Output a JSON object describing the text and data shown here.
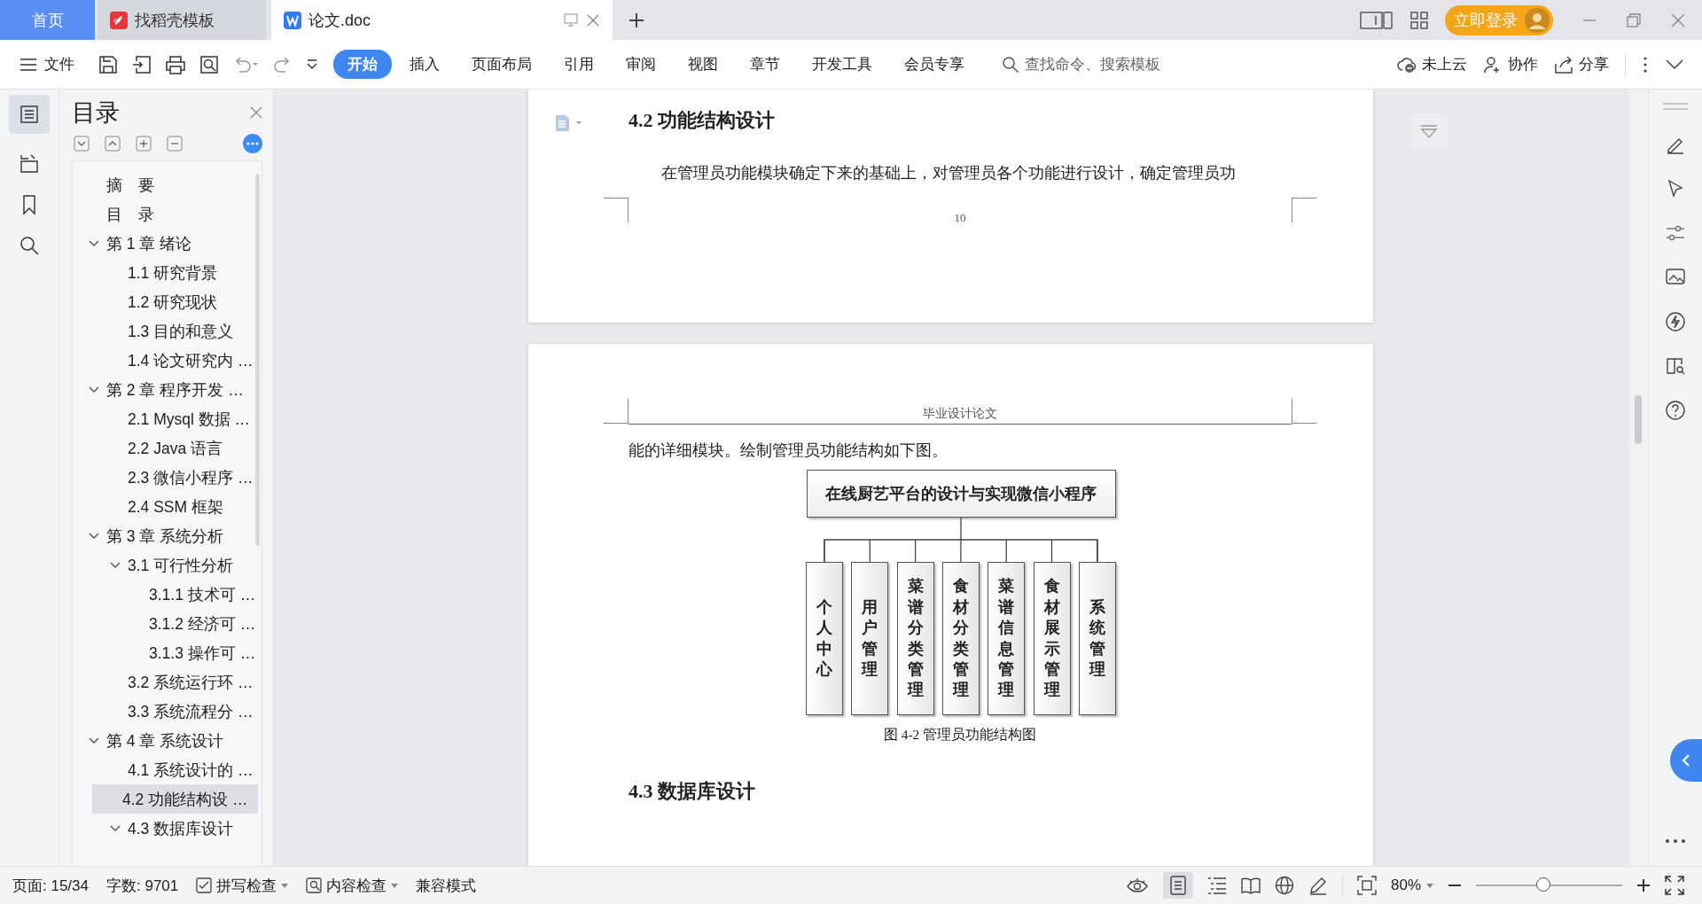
{
  "tabs": [
    {
      "kind": "home",
      "label": "首页",
      "selected": false
    },
    {
      "kind": "template",
      "label": "找稻壳模板",
      "selected": false
    },
    {
      "kind": "doc",
      "label": "论文.doc",
      "selected": true
    }
  ],
  "title_bar": {
    "login": "立即登录"
  },
  "toolbar": {
    "file_menu": "文件",
    "ribbon_tabs": [
      {
        "label": "开始",
        "selected": true
      },
      {
        "label": "插入",
        "selected": false
      },
      {
        "label": "页面布局",
        "selected": false
      },
      {
        "label": "引用",
        "selected": false
      },
      {
        "label": "审阅",
        "selected": false
      },
      {
        "label": "视图",
        "selected": false
      },
      {
        "label": "章节",
        "selected": false
      },
      {
        "label": "开发工具",
        "selected": false
      },
      {
        "label": "会员专享",
        "selected": false
      }
    ],
    "search": {
      "placeholder": "查找命令、搜索模板"
    },
    "actions": [
      {
        "kind": "cloud",
        "label": "未上云"
      },
      {
        "kind": "collab",
        "label": "协作"
      },
      {
        "kind": "share",
        "label": "分享"
      }
    ]
  },
  "toc": {
    "title": "目录",
    "items": [
      {
        "text": "摘　要",
        "selected": false
      },
      {
        "text": "目　录",
        "selected": false
      },
      {
        "text": "第 1 章  绪论",
        "selected": false,
        "expanded": true,
        "children": [
          {
            "text": "1.1  研究背景",
            "selected": false
          },
          {
            "text": "1.2  研究现状",
            "selected": false
          },
          {
            "text": "1.3  目的和意义",
            "selected": false
          },
          {
            "text": "1.4  论文研究内 …",
            "selected": false
          }
        ]
      },
      {
        "text": "第 2 章  程序开发 …",
        "selected": false,
        "expanded": true,
        "children": [
          {
            "text": "2.1 Mysql 数据 …",
            "selected": false
          },
          {
            "text": "2.2 Java 语言",
            "selected": false
          },
          {
            "text": "2.3  微信小程序 …",
            "selected": false
          },
          {
            "text": "2.4 SSM 框架",
            "selected": false
          }
        ]
      },
      {
        "text": "第 3 章  系统分析",
        "selected": false,
        "expanded": true,
        "children": [
          {
            "text": "3.1 可行性分析",
            "selected": false,
            "expanded": true,
            "children": [
              {
                "text": "3.1.1 技术可 …",
                "selected": false
              },
              {
                "text": "3.1.2 经济可 …",
                "selected": false
              },
              {
                "text": "3.1.3 操作可 …",
                "selected": false
              }
            ]
          },
          {
            "text": "3.2 系统运行环 …",
            "selected": false
          },
          {
            "text": "3.3 系统流程分 …",
            "selected": false
          }
        ]
      },
      {
        "text": "第 4 章  系统设计",
        "selected": false,
        "expanded": true,
        "children": [
          {
            "text": "4.1  系统设计的 …",
            "selected": false
          },
          {
            "text": "4.2  功能结构设 …",
            "selected": true
          },
          {
            "text": "4.3  数据库设计",
            "selected": false,
            "expanded": true
          }
        ]
      }
    ]
  },
  "document": {
    "page_one": {
      "heading": "4.2  功能结构设计",
      "paragraph": "在管理员功能模块确定下来的基础上，对管理员各个功能进行设计，确定管理员功",
      "page_number": "10"
    },
    "page_two": {
      "header": "毕业设计论文",
      "paragraph": "能的详细模块。绘制管理员功能结构如下图。",
      "diagram": {
        "root": "在线厨艺平台的设计与实现微信小程序",
        "modules": [
          "个人中心",
          "用户管理",
          "菜谱分类管理",
          "食材分类管理",
          "菜谱信息管理",
          "食材展示管理",
          "系统管理"
        ]
      },
      "caption": "图 4-2  管理员功能结构图",
      "heading": "4.3  数据库设计"
    }
  },
  "status_bar": {
    "page": "页面: 15/34",
    "words": "字数: 9701",
    "spell_check": "拼写检查",
    "content_check": "内容检查",
    "mode": "兼容模式",
    "zoom": "80%",
    "zoom_slider": {
      "level": 0.46
    }
  }
}
